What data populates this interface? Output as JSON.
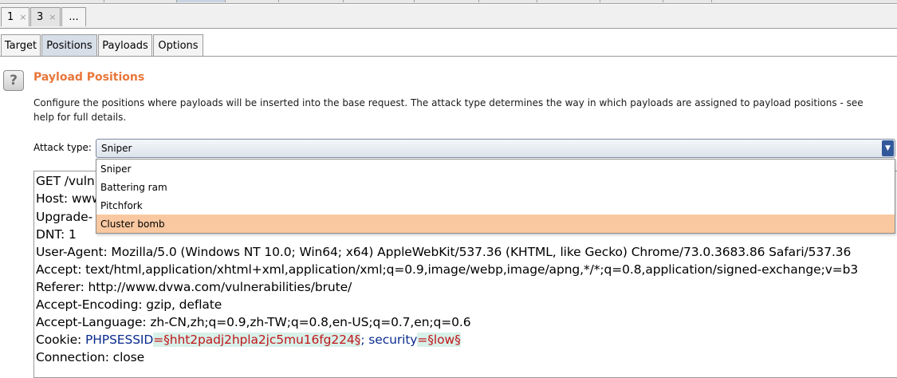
{
  "attack_tabs": [
    {
      "label": "1",
      "close": "×"
    },
    {
      "label": "3",
      "close": "×"
    },
    {
      "label": "..."
    }
  ],
  "sub_tabs": [
    "Target",
    "Positions",
    "Payloads",
    "Options"
  ],
  "section": {
    "help": "?",
    "title": "Payload Positions",
    "description": "Configure the positions where payloads will be inserted into the base request. The attack type determines the way in which payloads are assigned to payload positions - see help for full details."
  },
  "attack_type": {
    "label": "Attack type:",
    "value": "Sniper",
    "options": [
      "Sniper",
      "Battering ram",
      "Pitchfork",
      "Cluster bomb"
    ],
    "highlighted": "Cluster bomb"
  },
  "request": {
    "lines": [
      "GET /vuln",
      "Host: www",
      "Upgrade-",
      "DNT: 1",
      "User-Agent: Mozilla/5.0 (Windows NT 10.0; Win64; x64) AppleWebKit/537.36 (KHTML, like Gecko) Chrome/73.0.3683.86 Safari/537.36",
      "Accept: text/html,application/xhtml+xml,application/xml;q=0.9,image/webp,image/apng,*/*;q=0.8,application/signed-exchange;v=b3",
      "Referer: http://www.dvwa.com/vulnerabilities/brute/",
      "Accept-Encoding: gzip, deflate",
      "Accept-Language: zh-CN,zh;q=0.9,zh-TW;q=0.8,en-US;q=0.7,en;q=0.6"
    ],
    "cookie": {
      "prefix": "Cookie: ",
      "name1": "PHPSESSID",
      "eq1": "=",
      "payload1": "§hht2padj2hpla2jc5mu16fg224§",
      "sep": "; ",
      "name2": "security",
      "eq2": "=",
      "payload2": "§low§"
    },
    "last_line": "Connection: close"
  },
  "colors": {
    "title": "#e8763a",
    "selected_option": "#f9c8a0",
    "payload_text": "#c0171b",
    "payload_bg": "#d8f0e9",
    "cookie_name": "#0b2c8f",
    "dropdown_arrow": "#31589a"
  },
  "icons": {
    "help": "question-mark-icon",
    "select_arrow": "chevron-down-icon",
    "tab_close": "close-icon"
  }
}
